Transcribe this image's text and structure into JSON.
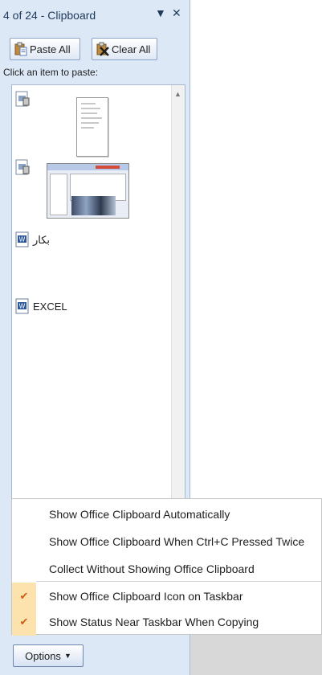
{
  "pane": {
    "title": "4 of 24 - Clipboard",
    "dropdown_glyph": "▼",
    "close_glyph": "✕"
  },
  "buttons": {
    "paste_all": "Paste All",
    "clear_all": "Clear All"
  },
  "hint": "Click an item to paste:",
  "items": [
    {
      "type": "image",
      "icon": "clipboard-image-icon",
      "text": ""
    },
    {
      "type": "image",
      "icon": "clipboard-image-icon",
      "text": ""
    },
    {
      "type": "word",
      "icon": "word-doc-icon",
      "text": "بکار"
    },
    {
      "type": "word",
      "icon": "word-doc-icon",
      "text": "EXCEL"
    }
  ],
  "menu": [
    {
      "label": "Show Office Clipboard Automatically",
      "checked": false
    },
    {
      "label": "Show Office Clipboard When Ctrl+C Pressed Twice",
      "checked": false
    },
    {
      "label": "Collect Without Showing Office Clipboard",
      "checked": false
    },
    {
      "label": "Show Office Clipboard Icon on Taskbar",
      "checked": true
    },
    {
      "label": "Show Status Near Taskbar When Copying",
      "checked": true
    }
  ],
  "check_glyph": "✔",
  "options_button": {
    "label": "Options",
    "arrow": "▼"
  },
  "colors": {
    "pane_bg": "#dde8f6",
    "check_highlight": "#fce2ad",
    "title_text": "#1e395b"
  }
}
